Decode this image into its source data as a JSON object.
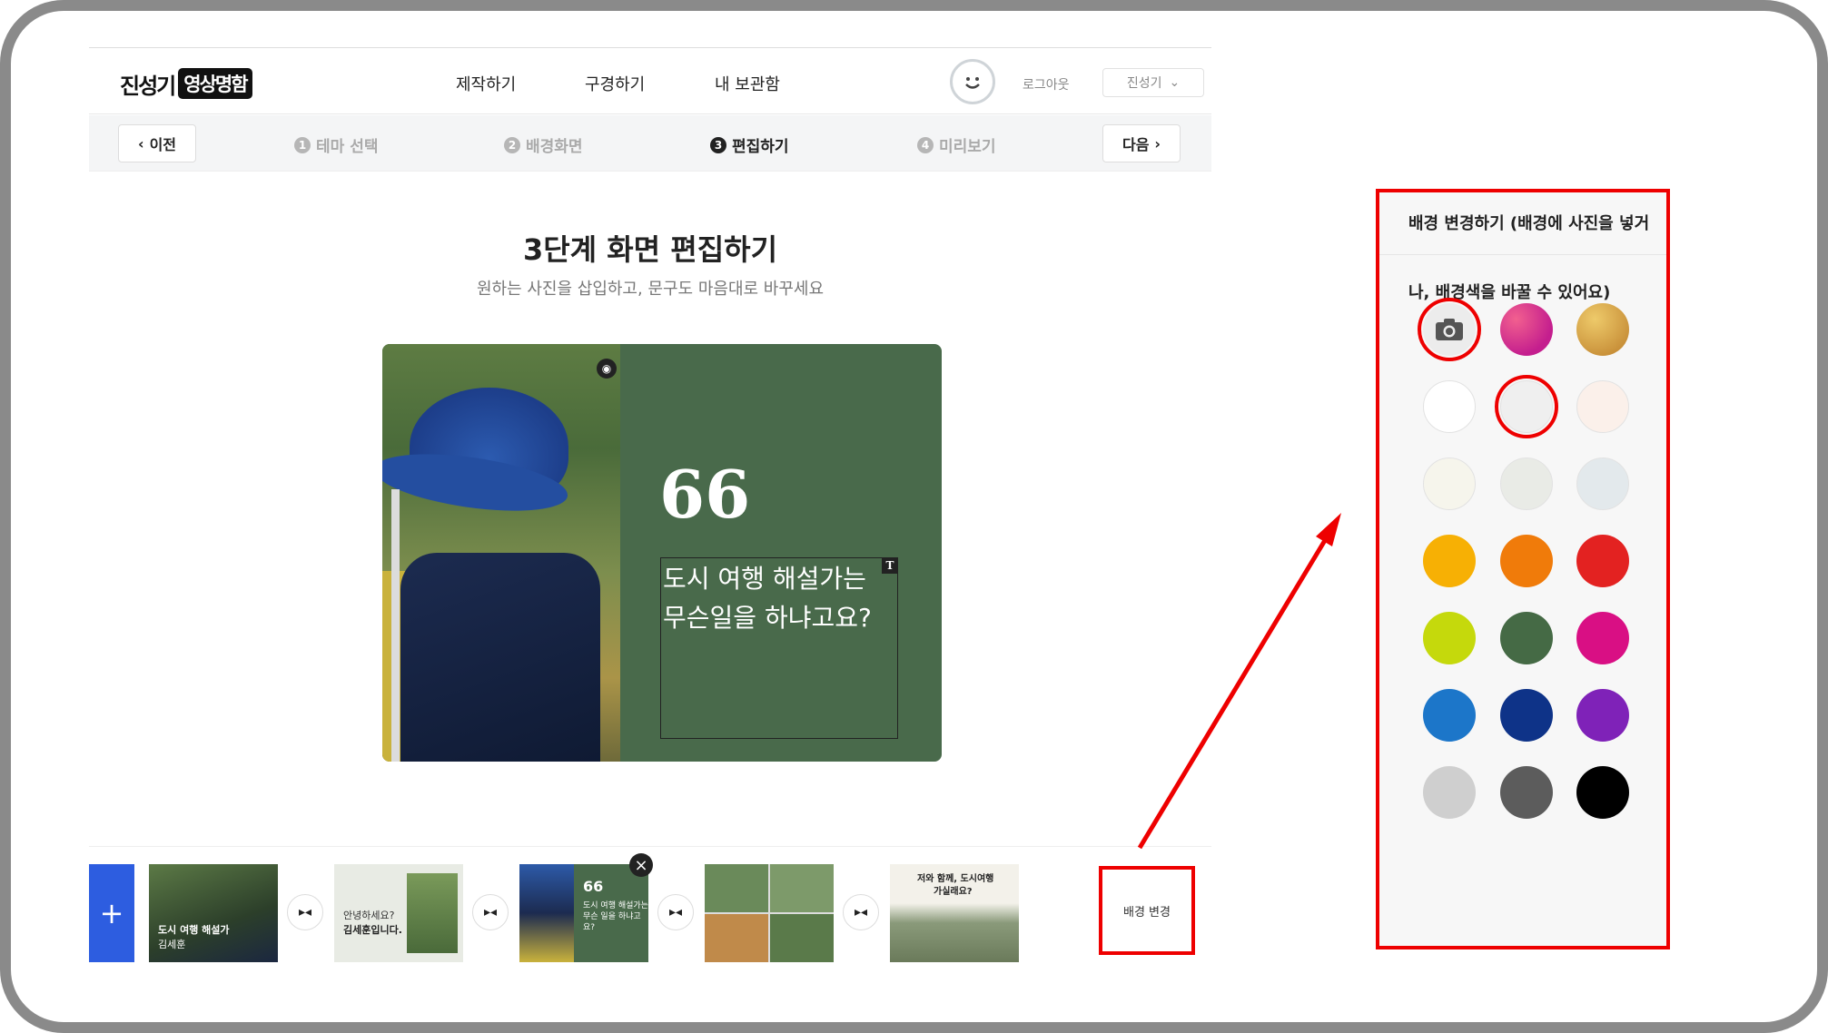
{
  "header": {
    "logo_part1": "진성기",
    "logo_part2": "영상명함",
    "nav": [
      "제작하기",
      "구경하기",
      "내 보관함"
    ],
    "logout": "로그아웃",
    "user": "진성기"
  },
  "steps": {
    "prev": "이전",
    "next": "다음",
    "items": [
      {
        "num": "1",
        "label": "테마 선택"
      },
      {
        "num": "2",
        "label": "배경화면"
      },
      {
        "num": "3",
        "label": "편집하기"
      },
      {
        "num": "4",
        "label": "미리보기"
      }
    ]
  },
  "page": {
    "title": "3단계 화면 편집하기",
    "subtitle": "원하는 사진을 삽입하고, 문구도 마음대로 바꾸세요"
  },
  "card": {
    "bg_color": "#496a4b",
    "quote_mark": "66",
    "text_line1": "도시 여행 해설가는",
    "text_line2": "무슨일을 하냐고요?"
  },
  "timeline": {
    "add": "+",
    "thumbs": [
      {
        "line1": "도시 여행 해설가",
        "line2": "김세훈"
      },
      {
        "line1": "안녕하세요?",
        "line2": "김세훈입니다."
      },
      {
        "line1": "도시 여행 해설가는",
        "line2": "무슨 일을 하냐고요?"
      },
      {
        "line1": "",
        "line2": ""
      },
      {
        "line1": "저와 함께, 도시여행",
        "line2": "가실래요?"
      }
    ],
    "bg_change": "배경 변경"
  },
  "panel": {
    "title": "배경 변경하기 (배경에 사진을 넣거",
    "subtitle": "나, 배경색을 바꿀 수 있어요)",
    "colors": [
      "camera",
      "#e0338f",
      "#d9a440",
      "#ffffff",
      "#efefef",
      "#fbf0ea",
      "#f6f5ec",
      "#e9ebe6",
      "#e3e9ec",
      "#f7b004",
      "#f07b0a",
      "#e32221",
      "#c5d90c",
      "#456a45",
      "#d90f84",
      "#1c76c9",
      "#0e3388",
      "#7f22b8",
      "#cfcfcf",
      "#5c5c5c",
      "#000000"
    ]
  }
}
